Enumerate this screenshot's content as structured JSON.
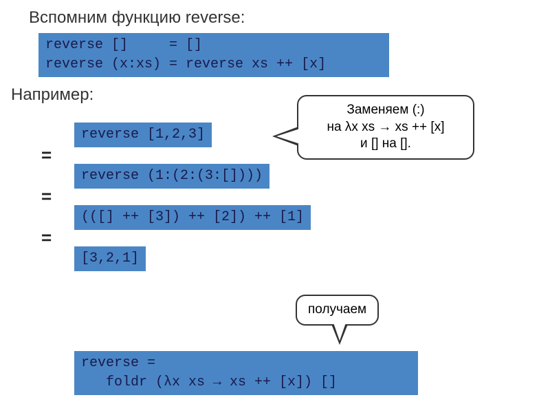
{
  "title": "Вспомним функцию reverse:",
  "definition": "reverse []     = []\nreverse (x:xs) = reverse xs ++ [x]",
  "example_label": "Например:",
  "steps": {
    "s1": "reverse [1,2,3]",
    "s2": "reverse (1:(2:(3:[])))",
    "s3": "(([] ++ [3]) ++ [2]) ++ [1]",
    "s4": "[3,2,1]"
  },
  "eq": "=",
  "bubble1_line1": "Заменяем (:)",
  "bubble1_line2": "на λx xs → xs ++ [x]",
  "bubble1_line3": "и [] на [].",
  "bubble2": "получаем",
  "final": "reverse =\n   foldr (λx xs → xs ++ [x]) []"
}
